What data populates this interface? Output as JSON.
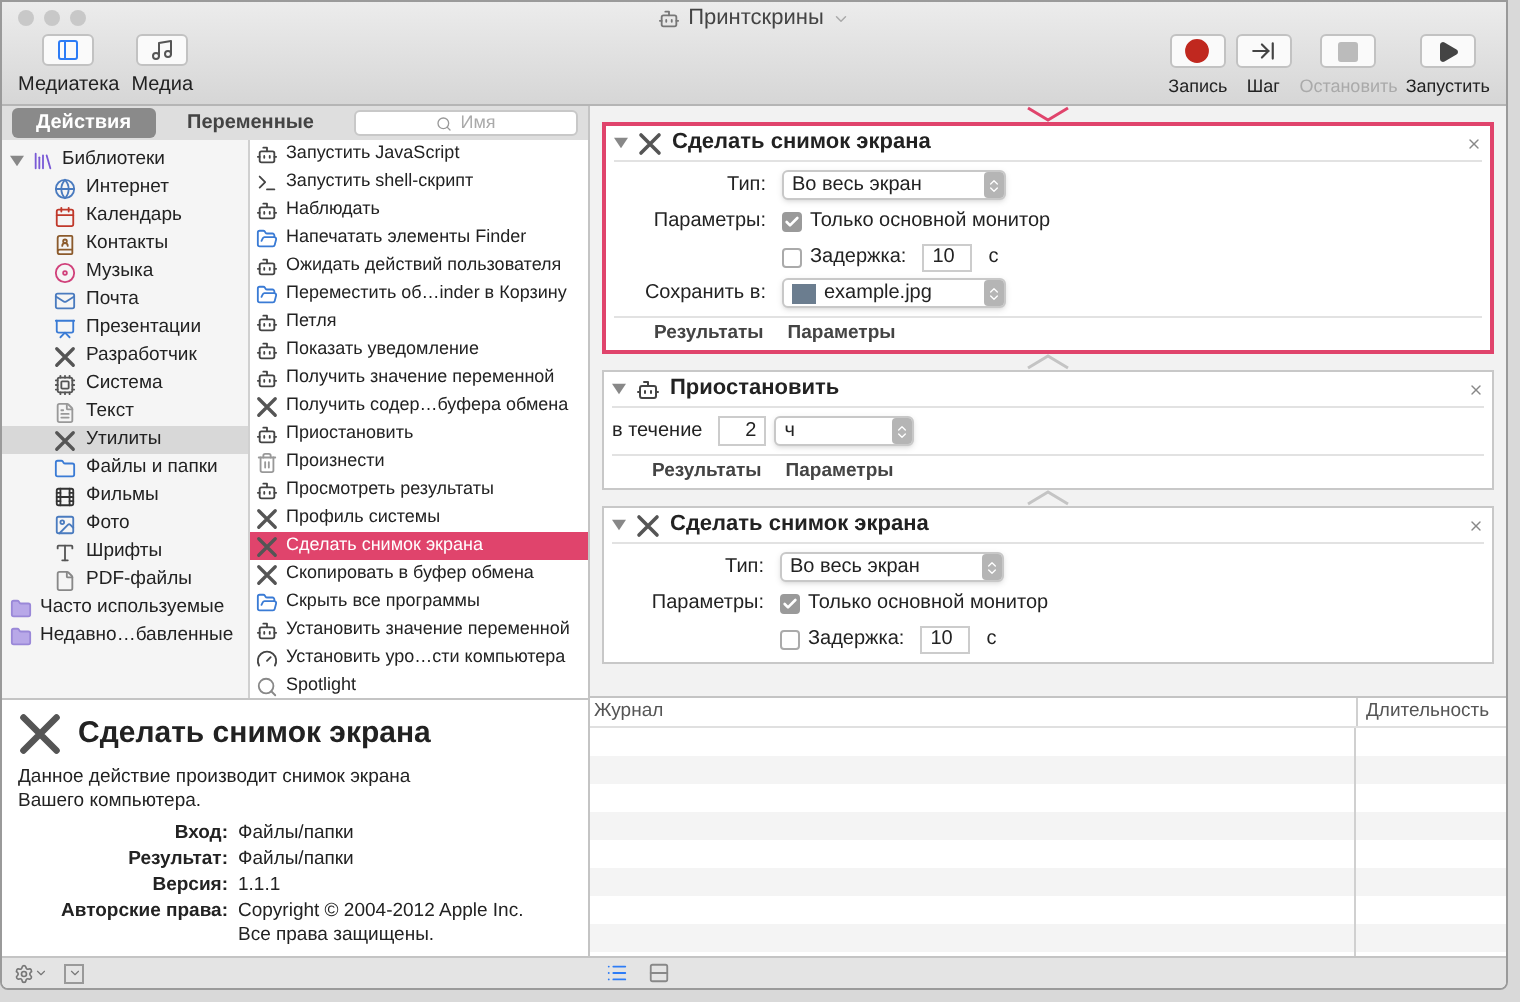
{
  "window": {
    "title": "Принтскрины"
  },
  "toolbar": {
    "left": [
      {
        "label": "Медиатека",
        "selected": true
      },
      {
        "label": "Медиа",
        "selected": false
      }
    ],
    "right": [
      {
        "label": "Запись",
        "kind": "record",
        "disabled": false
      },
      {
        "label": "Шаг",
        "kind": "step",
        "disabled": false
      },
      {
        "label": "Остановить",
        "kind": "stop",
        "disabled": true
      },
      {
        "label": "Запустить",
        "kind": "run",
        "disabled": false
      }
    ]
  },
  "library": {
    "tabs": [
      {
        "label": "Действия",
        "selected": true
      },
      {
        "label": "Переменные",
        "selected": false
      }
    ],
    "search": {
      "placeholder": "Имя"
    },
    "tree": [
      {
        "label": "Библиотеки",
        "expanded": true,
        "selected": false,
        "children": [
          {
            "label": "Интернет",
            "selected": false
          },
          {
            "label": "Календарь",
            "selected": false
          },
          {
            "label": "Контакты",
            "selected": false
          },
          {
            "label": "Музыка",
            "selected": false
          },
          {
            "label": "Почта",
            "selected": false
          },
          {
            "label": "Презентации",
            "selected": false
          },
          {
            "label": "Разработчик",
            "selected": false
          },
          {
            "label": "Система",
            "selected": false
          },
          {
            "label": "Текст",
            "selected": false
          },
          {
            "label": "Утилиты",
            "selected": true
          },
          {
            "label": "Файлы и папки",
            "selected": false
          },
          {
            "label": "Фильмы",
            "selected": false
          },
          {
            "label": "Фото",
            "selected": false
          },
          {
            "label": "Шрифты",
            "selected": false
          },
          {
            "label": "PDF-файлы",
            "selected": false
          }
        ]
      },
      {
        "label": "Часто используемые",
        "selected": false
      },
      {
        "label": "Недавно…бавленные",
        "selected": false
      }
    ],
    "actions": [
      {
        "label": "Запустить JavaScript",
        "selected": false
      },
      {
        "label": "Запустить shell-скрипт",
        "selected": false
      },
      {
        "label": "Наблюдать",
        "selected": false
      },
      {
        "label": "Напечатать элементы Finder",
        "selected": false
      },
      {
        "label": "Ожидать действий пользователя",
        "selected": false
      },
      {
        "label": "Переместить об…inder в Корзину",
        "selected": false
      },
      {
        "label": "Петля",
        "selected": false
      },
      {
        "label": "Показать уведомление",
        "selected": false
      },
      {
        "label": "Получить значение переменной",
        "selected": false
      },
      {
        "label": "Получить содер…буфера обмена",
        "selected": false
      },
      {
        "label": "Приостановить",
        "selected": false
      },
      {
        "label": "Произнести",
        "selected": false
      },
      {
        "label": "Просмотреть результаты",
        "selected": false
      },
      {
        "label": "Профиль системы",
        "selected": false
      },
      {
        "label": "Сделать снимок экрана",
        "selected": true
      },
      {
        "label": "Скопировать в буфер обмена",
        "selected": false
      },
      {
        "label": "Скрыть все программы",
        "selected": false
      },
      {
        "label": "Установить значение переменной",
        "selected": false
      },
      {
        "label": "Установить уро…сти компьютера",
        "selected": false
      },
      {
        "label": "Spotlight",
        "selected": false
      }
    ]
  },
  "description": {
    "title": "Сделать снимок экрана",
    "text": "Данное действие производит снимок экрана Вашего компьютера.",
    "properties": [
      {
        "label": "Вход:",
        "value": "Файлы/папки"
      },
      {
        "label": "Результат:",
        "value": "Файлы/папки"
      },
      {
        "label": "Версия:",
        "value": "1.1.1"
      },
      {
        "label": "Авторские права:",
        "value": "Copyright © 2004-2012 Apple Inc. Все права защищены."
      }
    ]
  },
  "workflow": [
    {
      "kind": "tools",
      "title": "Сделать снимок экрана",
      "selected": true,
      "expanded": true,
      "footer": [
        "Результаты",
        "Параметры"
      ],
      "rows": [
        {
          "kind": "select",
          "label": "Тип:",
          "value": "Во весь экран"
        },
        {
          "kind": "checkbox",
          "label": "Параметры:",
          "text": "Только основной монитор",
          "checked": true
        },
        {
          "kind": "delay",
          "text": "Задержка:",
          "checked": false,
          "value": "10",
          "unit": "с"
        },
        {
          "kind": "file",
          "label": "Сохранить в:",
          "value": "example.jpg"
        }
      ]
    },
    {
      "kind": "robot",
      "title": "Приостановить",
      "selected": false,
      "expanded": true,
      "footer": [
        "Результаты",
        "Параметры"
      ],
      "rows": [
        {
          "kind": "duration",
          "label": "в течение",
          "value": "2",
          "unit": "ч"
        }
      ]
    },
    {
      "kind": "tools",
      "title": "Сделать снимок экрана",
      "selected": false,
      "expanded": true,
      "rows": [
        {
          "kind": "select",
          "label": "Тип:",
          "value": "Во весь экран"
        },
        {
          "kind": "checkbox",
          "label": "Параметры:",
          "text": "Только основной монитор",
          "checked": true
        },
        {
          "kind": "delay",
          "text": "Задержка:",
          "checked": false,
          "value": "10",
          "unit": "с"
        }
      ]
    }
  ],
  "log": {
    "columns": [
      "Журнал",
      "Длительность"
    ]
  },
  "view_buttons": [
    {
      "selected": true
    },
    {
      "selected": false
    }
  ]
}
